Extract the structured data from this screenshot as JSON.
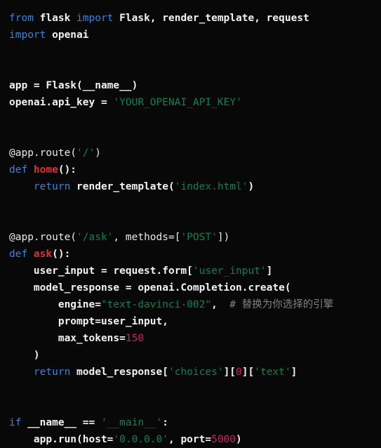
{
  "editor": {
    "language": "python",
    "background_color": "#080808",
    "colors": {
      "plain": "#f2f2f2",
      "keyword": "#3b82dd",
      "string": "#0d8050",
      "number": "#d01c61",
      "function": "#e03030",
      "comment": "#808080",
      "decorator": "#eaeaea"
    },
    "lines": [
      {
        "n": 1,
        "tokens": [
          {
            "t": "from ",
            "c": "keyword"
          },
          {
            "t": "flask ",
            "c": "plain"
          },
          {
            "t": "import ",
            "c": "keyword"
          },
          {
            "t": "Flask, render_template, request",
            "c": "plain"
          }
        ]
      },
      {
        "n": 2,
        "tokens": [
          {
            "t": "import ",
            "c": "keyword"
          },
          {
            "t": "openai",
            "c": "plain"
          }
        ]
      },
      {
        "n": 3,
        "tokens": []
      },
      {
        "n": 4,
        "tokens": []
      },
      {
        "n": 5,
        "tokens": [
          {
            "t": "app = Flask(__name__)",
            "c": "plain"
          }
        ]
      },
      {
        "n": 6,
        "tokens": [
          {
            "t": "openai.api_key = ",
            "c": "plain"
          },
          {
            "t": "'YOUR_OPENAI_API_KEY'",
            "c": "string"
          }
        ]
      },
      {
        "n": 7,
        "tokens": []
      },
      {
        "n": 8,
        "tokens": []
      },
      {
        "n": 9,
        "tokens": [
          {
            "t": "@app.route(",
            "c": "decorator"
          },
          {
            "t": "'/'",
            "c": "string"
          },
          {
            "t": ")",
            "c": "decorator"
          }
        ]
      },
      {
        "n": 10,
        "tokens": [
          {
            "t": "def ",
            "c": "keyword"
          },
          {
            "t": "home",
            "c": "function"
          },
          {
            "t": "():",
            "c": "punct"
          }
        ]
      },
      {
        "n": 11,
        "tokens": [
          {
            "t": "    ",
            "c": "plain"
          },
          {
            "t": "return ",
            "c": "keyword"
          },
          {
            "t": "render_template(",
            "c": "plain"
          },
          {
            "t": "'index.html'",
            "c": "string"
          },
          {
            "t": ")",
            "c": "plain"
          }
        ]
      },
      {
        "n": 12,
        "tokens": []
      },
      {
        "n": 13,
        "tokens": []
      },
      {
        "n": 14,
        "tokens": [
          {
            "t": "@app.route(",
            "c": "decorator"
          },
          {
            "t": "'/ask'",
            "c": "string"
          },
          {
            "t": ", methods=[",
            "c": "decorator"
          },
          {
            "t": "'POST'",
            "c": "string"
          },
          {
            "t": "])",
            "c": "decorator"
          }
        ]
      },
      {
        "n": 15,
        "tokens": [
          {
            "t": "def ",
            "c": "keyword"
          },
          {
            "t": "ask",
            "c": "function"
          },
          {
            "t": "():",
            "c": "punct"
          }
        ]
      },
      {
        "n": 16,
        "tokens": [
          {
            "t": "    user_input = request.form[",
            "c": "plain"
          },
          {
            "t": "'user_input'",
            "c": "string"
          },
          {
            "t": "]",
            "c": "plain"
          }
        ]
      },
      {
        "n": 17,
        "tokens": [
          {
            "t": "    model_response = openai.Completion.create(",
            "c": "plain"
          }
        ]
      },
      {
        "n": 18,
        "tokens": [
          {
            "t": "        engine=",
            "c": "plain"
          },
          {
            "t": "\"text-davinci-002\"",
            "c": "string"
          },
          {
            "t": ",  ",
            "c": "plain"
          },
          {
            "t": "# 替换为你选择的引擎",
            "c": "comment"
          }
        ]
      },
      {
        "n": 19,
        "tokens": [
          {
            "t": "        prompt=user_input,",
            "c": "plain"
          }
        ]
      },
      {
        "n": 20,
        "tokens": [
          {
            "t": "        max_tokens=",
            "c": "plain"
          },
          {
            "t": "150",
            "c": "number"
          }
        ]
      },
      {
        "n": 21,
        "tokens": [
          {
            "t": "    )",
            "c": "plain"
          }
        ]
      },
      {
        "n": 22,
        "tokens": [
          {
            "t": "    ",
            "c": "plain"
          },
          {
            "t": "return ",
            "c": "keyword"
          },
          {
            "t": "model_response[",
            "c": "plain"
          },
          {
            "t": "'choices'",
            "c": "string"
          },
          {
            "t": "][",
            "c": "plain"
          },
          {
            "t": "0",
            "c": "number"
          },
          {
            "t": "][",
            "c": "plain"
          },
          {
            "t": "'text'",
            "c": "string"
          },
          {
            "t": "]",
            "c": "plain"
          }
        ]
      },
      {
        "n": 23,
        "tokens": []
      },
      {
        "n": 24,
        "tokens": []
      },
      {
        "n": 25,
        "tokens": [
          {
            "t": "if ",
            "c": "keyword"
          },
          {
            "t": "__name__ == ",
            "c": "plain"
          },
          {
            "t": "'__main__'",
            "c": "string"
          },
          {
            "t": ":",
            "c": "plain"
          }
        ]
      },
      {
        "n": 26,
        "tokens": [
          {
            "t": "    app.run(host=",
            "c": "plain"
          },
          {
            "t": "'0.0.0.0'",
            "c": "string"
          },
          {
            "t": ", port=",
            "c": "plain"
          },
          {
            "t": "5000",
            "c": "number"
          },
          {
            "t": ")",
            "c": "plain"
          }
        ]
      }
    ]
  }
}
